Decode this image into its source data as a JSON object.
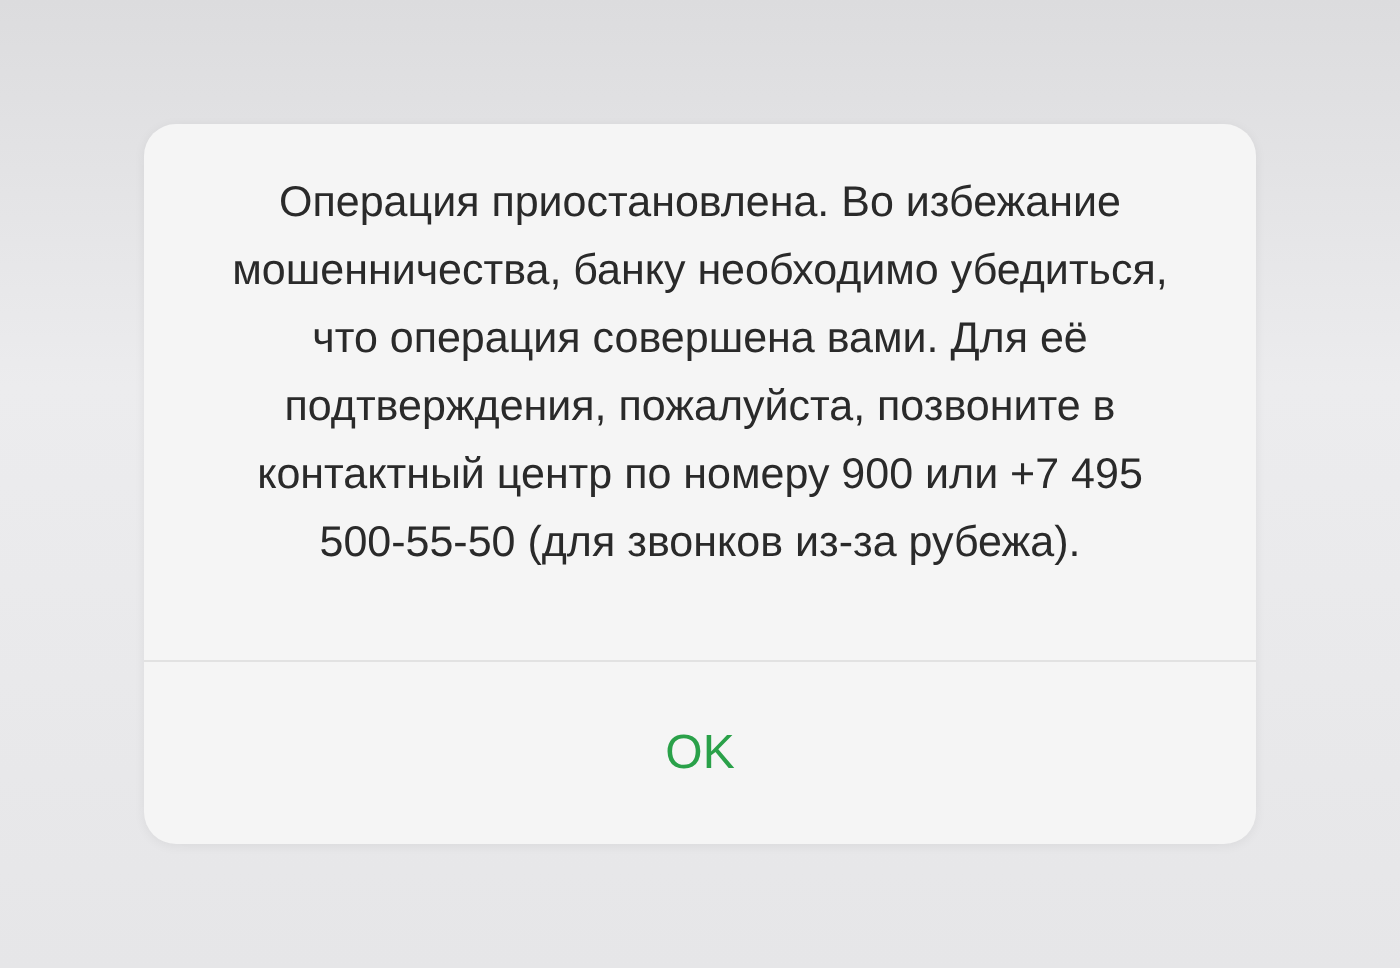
{
  "alert": {
    "message": "Операция приостановлена. Во избежание мошенничества, банку необходимо убедиться, что операция совершена вами. Для её подтверждения, пожалуйста, позвоните в контактный центр по номеру 900 или +7 495 500-55-50 (для звонков из-за рубежа).",
    "buttons": [
      {
        "label": "OK",
        "kind": "confirm"
      }
    ]
  }
}
